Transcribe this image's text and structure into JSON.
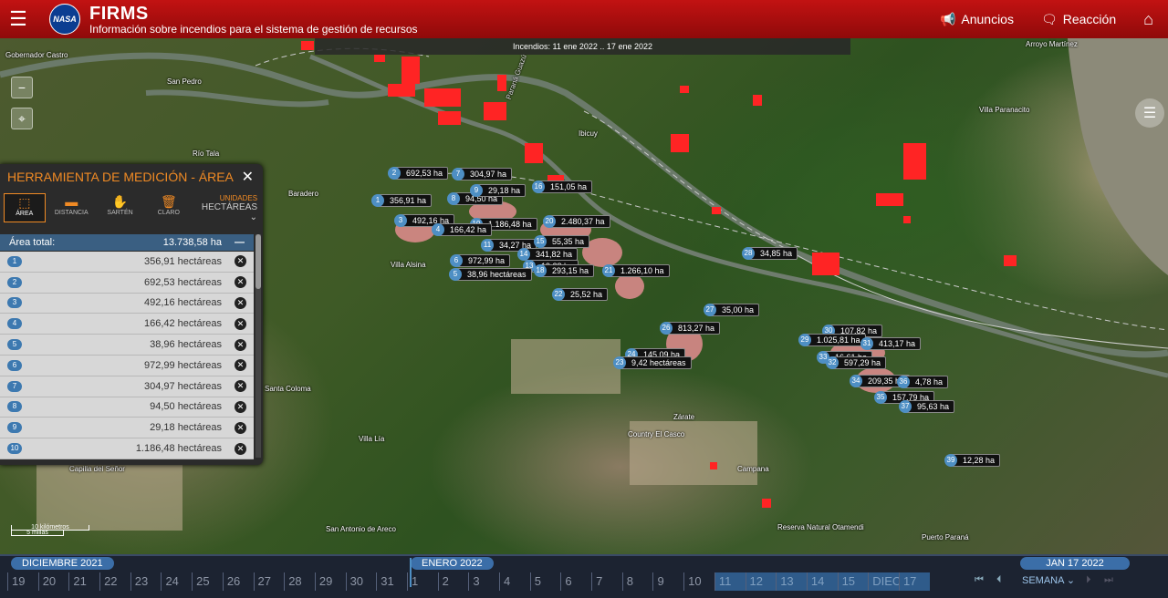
{
  "header": {
    "title": "FIRMS",
    "subtitle": "Información sobre incendios para el sistema de gestión de recursos",
    "logo_text": "NASA",
    "announcements": "Anuncios",
    "feedback": "Reacción"
  },
  "date_range": "Incendios: 11 ene 2022 .. 17 ene 2022",
  "map_labels": [
    "Gobernador Castro",
    "San Pedro",
    "Río Tala",
    "Baradero",
    "Villa Alsina",
    "Ibicuy",
    "Villa Paranacito",
    "Arroyo Martínez",
    "Santa Coloma",
    "Villa Lía",
    "Capilla del Señor",
    "Zárate",
    "Country El Casco",
    "Campana",
    "Reserva Natural Otamendi",
    "Puerto Paraná",
    "San Antonio de Areco",
    "Paraná Guazú"
  ],
  "measurements": [
    {
      "n": "2",
      "v": "692,53 ha"
    },
    {
      "n": "7",
      "v": "304,97 ha"
    },
    {
      "n": "1",
      "v": "356,91 ha"
    },
    {
      "n": "8",
      "v": "94,50 ha"
    },
    {
      "n": "9",
      "v": "29,18 ha"
    },
    {
      "n": "16",
      "v": "151,05 ha"
    },
    {
      "n": "3",
      "v": "492,16 ha"
    },
    {
      "n": "10",
      "v": "1.186,48 ha"
    },
    {
      "n": "4",
      "v": "166,42 ha"
    },
    {
      "n": "20",
      "v": "2.480,37 ha"
    },
    {
      "n": "11",
      "v": "34,27 ha"
    },
    {
      "n": "15",
      "v": "55,35 ha"
    },
    {
      "n": "14",
      "v": "341,82 ha"
    },
    {
      "n": "6",
      "v": "972,99 ha"
    },
    {
      "n": "13",
      "v": "19,28 ha"
    },
    {
      "n": "5",
      "v": "38,96 hectáreas"
    },
    {
      "n": "18",
      "v": "293,15 ha"
    },
    {
      "n": "21",
      "v": "1.266,10 ha"
    },
    {
      "n": "22",
      "v": "25,52 ha"
    },
    {
      "n": "28",
      "v": "34,85 ha"
    },
    {
      "n": "27",
      "v": "35,00 ha"
    },
    {
      "n": "26",
      "v": "813,27 ha"
    },
    {
      "n": "24",
      "v": "145,09 ha"
    },
    {
      "n": "23",
      "v": "9,42 hectáreas"
    },
    {
      "n": "30",
      "v": "107,82 ha"
    },
    {
      "n": "29",
      "v": "1.025,81 ha"
    },
    {
      "n": "31",
      "v": "413,17 ha"
    },
    {
      "n": "33",
      "v": "16,61 ha"
    },
    {
      "n": "32",
      "v": "597,29 ha"
    },
    {
      "n": "34",
      "v": "209,35 ha"
    },
    {
      "n": "36",
      "v": "4,78 ha"
    },
    {
      "n": "35",
      "v": "157,79 ha"
    },
    {
      "n": "37",
      "v": "95,63 ha"
    },
    {
      "n": "39",
      "v": "12,28 ha"
    }
  ],
  "panel": {
    "title": "HERRAMIENTA DE MEDICIÓN - ÁREA",
    "tools": [
      {
        "label": "ÁREA",
        "icon": "area-icon"
      },
      {
        "label": "DISTANCIA",
        "icon": "ruler-icon"
      },
      {
        "label": "SARTÉN",
        "icon": "hand-icon"
      },
      {
        "label": "CLARO",
        "icon": "trash-icon"
      }
    ],
    "units_label": "UNIDADES",
    "units_value": "HECTÁREAS",
    "total_label": "Área total:",
    "total_value": "13.738,58 ha",
    "rows": [
      {
        "n": "1",
        "v": "356,91 hectáreas"
      },
      {
        "n": "2",
        "v": "692,53 hectáreas"
      },
      {
        "n": "3",
        "v": "492,16 hectáreas"
      },
      {
        "n": "4",
        "v": "166,42 hectáreas"
      },
      {
        "n": "5",
        "v": "38,96 hectáreas"
      },
      {
        "n": "6",
        "v": "972,99 hectáreas"
      },
      {
        "n": "7",
        "v": "304,97 hectáreas"
      },
      {
        "n": "8",
        "v": "94,50 hectáreas"
      },
      {
        "n": "9",
        "v": "29,18 hectáreas"
      },
      {
        "n": "10",
        "v": "1.186,48 hectáreas"
      }
    ]
  },
  "scale": {
    "km": "10 kilómetros",
    "mi": "5 millas"
  },
  "timeline": {
    "month1": "DICIEMBRE 2021",
    "month2": "ENERO 2022",
    "days": [
      "19",
      "20",
      "21",
      "22",
      "23",
      "24",
      "25",
      "26",
      "27",
      "28",
      "29",
      "30",
      "31",
      "1",
      "2",
      "3",
      "4",
      "5",
      "6",
      "7",
      "8",
      "9",
      "10",
      "11",
      "12",
      "13",
      "14",
      "15",
      "DIEC",
      "17"
    ],
    "current": "JAN 17 2022",
    "period": "SEMANA"
  },
  "colors": {
    "header": "#b01010",
    "accent": "#f08a24",
    "fire": "#ff2424",
    "tag_number": "#4e8fc4"
  }
}
